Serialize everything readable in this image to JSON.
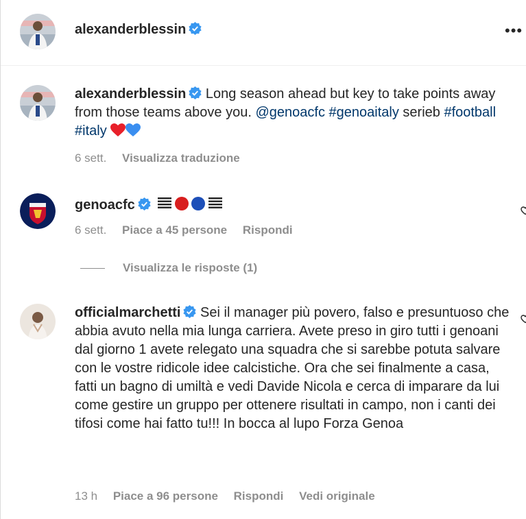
{
  "post": {
    "header_username": "alexanderblessin",
    "more_label": "•••"
  },
  "caption": {
    "username": "alexanderblessin",
    "text_part1": "Long season ahead but key to take points away from those teams above you.",
    "mention": "@genoacfc",
    "hashtag1": "#genoaitaly",
    "text_part2": "serieb",
    "hashtag2": "#football",
    "hashtag3": "#italy",
    "time": "6 sett.",
    "translate_label": "Visualizza traduzione"
  },
  "comments": [
    {
      "username": "genoacfc",
      "time": "6 sett.",
      "likes": "Piace a 45 persone",
      "reply_label": "Rispondi",
      "view_replies": "Visualizza le risposte (1)"
    },
    {
      "username": "officialmarchetti",
      "text": "Sei il manager più povero, falso e presuntuoso che abbia avuto nella mia lunga carriera. Avete preso in giro tutti i genoani dal giorno 1 avete relegato una squadra che si sarebbe potuta salvare con le vostre ridicole idee calcistiche. Ora che sei finalmente a casa, fatti un bagno di umiltà e vedi Davide Nicola e cerca di imparare da lui come gestire un gruppo per ottenere risultati in campo, non i canti dei tifosi come hai fatto tu!!! In bocca al lupo Forza Genoa",
      "time": "13 h",
      "likes": "Piace a 96 persone",
      "reply_label": "Rispondi",
      "original_label": "Vedi originale"
    }
  ],
  "colors": {
    "verified": "#3897f0",
    "link": "#00376b",
    "muted": "#8e8e8e",
    "genoa_red": "#c8102e",
    "genoa_blue": "#0a1e5a"
  }
}
